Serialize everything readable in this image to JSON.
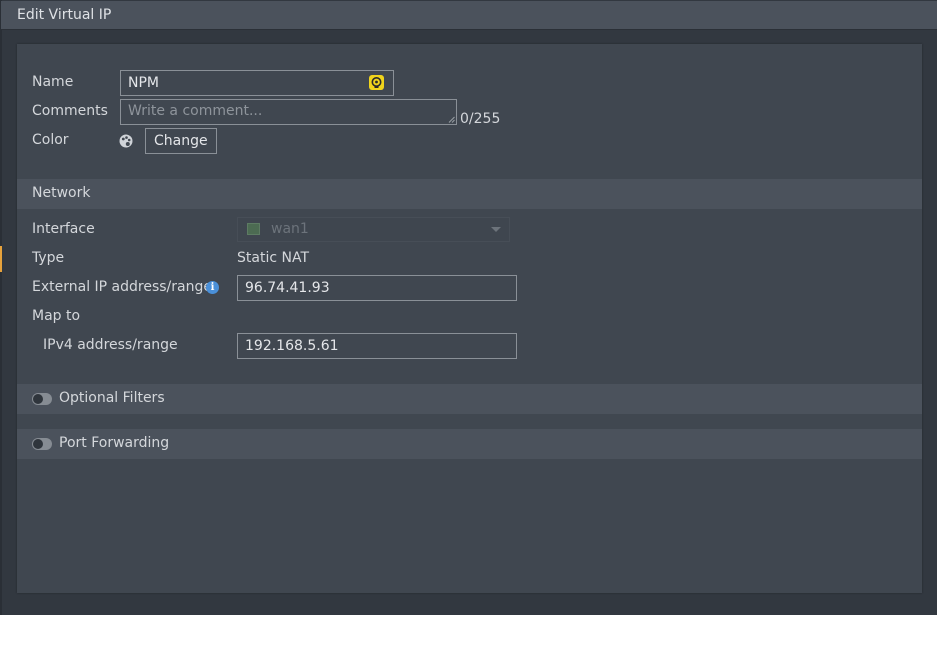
{
  "window": {
    "title": "Edit Virtual IP"
  },
  "form": {
    "name": {
      "label": "Name",
      "value": "NPM"
    },
    "comments": {
      "label": "Comments",
      "placeholder": "Write a comment...",
      "counter": "0/255"
    },
    "color": {
      "label": "Color",
      "button": "Change"
    }
  },
  "network": {
    "section_title": "Network",
    "interface": {
      "label": "Interface",
      "value": "wan1"
    },
    "type": {
      "label": "Type",
      "value": "Static NAT"
    },
    "external_ip": {
      "label": "External IP address/range",
      "value": "96.74.41.93"
    },
    "map_to": {
      "label": "Map to"
    },
    "ipv4": {
      "label": "IPv4 address/range",
      "value": "192.168.5.61"
    }
  },
  "optional_filters": {
    "label": "Optional Filters",
    "enabled": false
  },
  "port_forwarding": {
    "label": "Port Forwarding",
    "enabled": false
  },
  "colors": {
    "accent": "#e6a23c",
    "name_icon": "#f0d41c",
    "info": "#4a90d9"
  }
}
